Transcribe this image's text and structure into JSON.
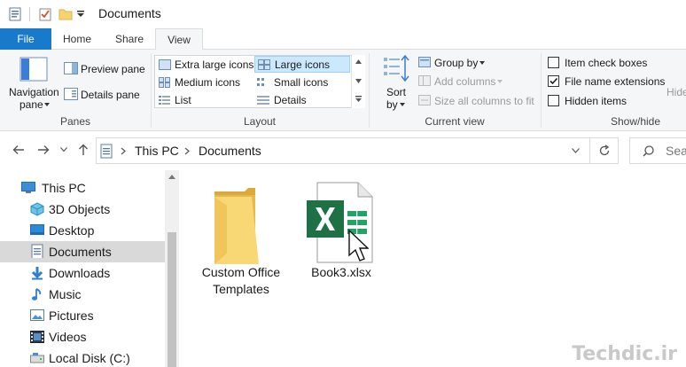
{
  "window": {
    "title": "Documents"
  },
  "tabs": [
    {
      "label": "File"
    },
    {
      "label": "Home"
    },
    {
      "label": "Share"
    },
    {
      "label": "View"
    }
  ],
  "ribbon": {
    "panes": {
      "navigation_pane_line1": "Navigation",
      "navigation_pane_line2": "pane",
      "preview_pane": "Preview pane",
      "details_pane": "Details pane",
      "group_label": "Panes"
    },
    "layout": {
      "items": [
        "Extra large icons",
        "Large icons",
        "Medium icons",
        "Small icons",
        "List",
        "Details"
      ],
      "selected": "Large icons",
      "group_label": "Layout"
    },
    "current_view": {
      "sort_line1": "Sort",
      "sort_line2": "by",
      "group_by": "Group by",
      "add_columns": "Add columns",
      "size_all_columns": "Size all columns to fit",
      "group_label": "Current view"
    },
    "show_hide": {
      "item_check_boxes": "Item check boxes",
      "item_check_boxes_checked": false,
      "file_name_extensions": "File name extensions",
      "file_name_extensions_checked": true,
      "hidden_items": "Hidden items",
      "hidden_items_checked": false,
      "hide_partial": "Hide",
      "group_label": "Show/hide"
    }
  },
  "address": {
    "crumbs": [
      "This PC",
      "Documents"
    ],
    "search_placeholder": "Sear"
  },
  "nav_tree": [
    {
      "label": "This PC",
      "icon": "pc-icon"
    },
    {
      "label": "3D Objects",
      "icon": "cube-icon"
    },
    {
      "label": "Desktop",
      "icon": "desktop-icon"
    },
    {
      "label": "Documents",
      "icon": "document-icon"
    },
    {
      "label": "Downloads",
      "icon": "download-icon"
    },
    {
      "label": "Music",
      "icon": "music-icon"
    },
    {
      "label": "Pictures",
      "icon": "pictures-icon"
    },
    {
      "label": "Videos",
      "icon": "videos-icon"
    },
    {
      "label": "Local Disk (C:)",
      "icon": "disk-icon"
    }
  ],
  "nav_selected": "Documents",
  "files": [
    {
      "line1": "Custom Office",
      "line2": "Templates",
      "icon": "folder-icon"
    },
    {
      "line1": "Book3.xlsx",
      "icon": "excel-file-icon"
    }
  ],
  "watermark": "Techdic.ir",
  "colors": {
    "file_tab": "#1979ca",
    "selection": "#cce8ff",
    "folder": "#f5d36e",
    "excel": "#1e7145"
  }
}
